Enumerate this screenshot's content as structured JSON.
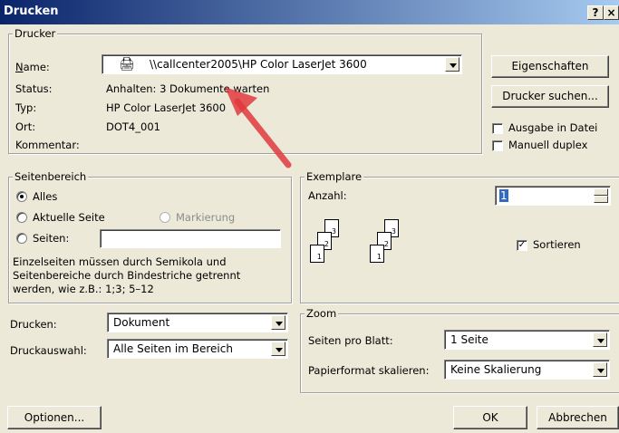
{
  "window": {
    "title": "Drucken",
    "help_label": "?",
    "close_label": "×"
  },
  "drucker": {
    "legend": "Drucker",
    "name_label": "Name:",
    "name_value": "\\\\callcenter2005\\HP Color LaserJet 3600",
    "status_label": "Status:",
    "status_value": "Anhalten: 3 Dokumente warten",
    "typ_label": "Typ:",
    "typ_value": "HP Color LaserJet 3600",
    "ort_label": "Ort:",
    "ort_value": "DOT4_001",
    "kommentar_label": "Kommentar:",
    "eigenschaften_label": "Eigenschaften",
    "drucker_suchen_label": "Drucker suchen...",
    "ausgabe_datei_label": "Ausgabe in Datei",
    "ausgabe_datei_checked": false,
    "duplex_label": "Manuell duplex",
    "duplex_checked": false
  },
  "seitenbereich": {
    "legend": "Seitenbereich",
    "alles_label": "Alles",
    "aktuelle_label": "Aktuelle Seite",
    "markierung_label": "Markierung",
    "seiten_label": "Seiten:",
    "seiten_value": "",
    "selected": "alles",
    "hint_line1": "Einzelseiten müssen durch Semikola und",
    "hint_line2": "Seitenbereiche durch Bindestriche getrennt",
    "hint_line3": "werden, wie z.B.: 1;3; 5–12"
  },
  "exemplare": {
    "legend": "Exemplare",
    "anzahl_label": "Anzahl:",
    "anzahl_value": "1",
    "sortieren_label": "Sortieren",
    "sortieren_checked": true,
    "page_numbers": [
      "1",
      "2",
      "3"
    ]
  },
  "drucken_section": {
    "drucken_label": "Drucken:",
    "drucken_value": "Dokument",
    "auswahl_label": "Druckauswahl:",
    "auswahl_value": "Alle Seiten im Bereich"
  },
  "zoom": {
    "legend": "Zoom",
    "seiten_pro_blatt_label": "Seiten pro Blatt:",
    "seiten_pro_blatt_value": "1 Seite",
    "skalieren_label": "Papierformat skalieren:",
    "skalieren_value": "Keine Skalierung"
  },
  "footer": {
    "optionen_label": "Optionen...",
    "ok_label": "OK",
    "abbrechen_label": "Abbrechen"
  },
  "colors": {
    "titlebar": "#0a246a",
    "annotation_arrow": "#e0393e"
  }
}
